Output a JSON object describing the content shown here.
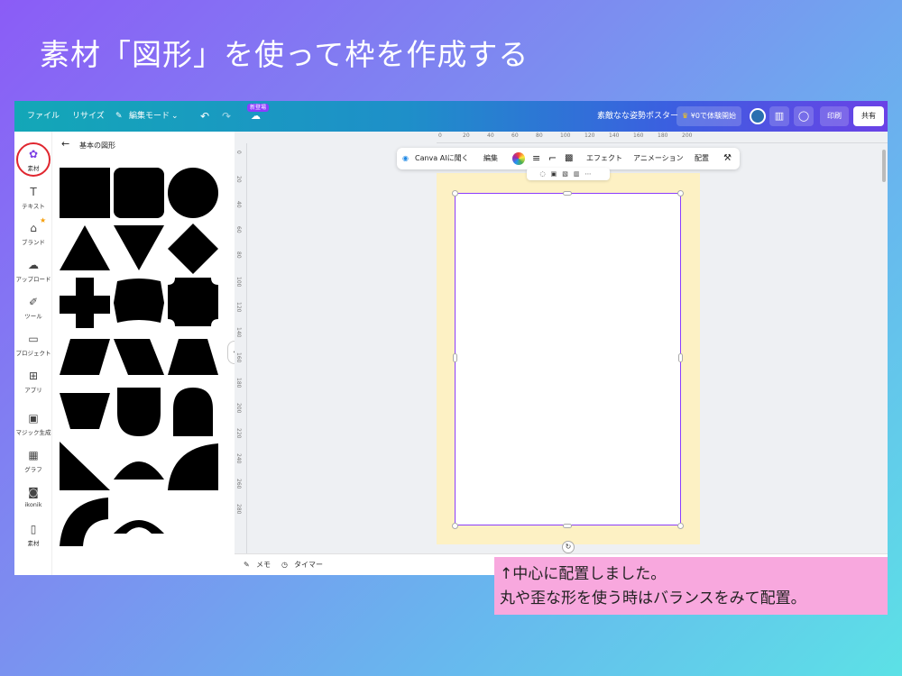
{
  "slide": {
    "title": "素材「図形」を使って枠を作成する",
    "note_line1": "↑中心に配置しました。",
    "note_line2": "丸や歪な形を使う時はバランスをみて配置。"
  },
  "topbar": {
    "file": "ファイル",
    "resize": "リサイズ",
    "edit_mode": "編集モード",
    "new_badge": "新登場",
    "doc_title": "素敵なな姿勢ポスター",
    "trial": "¥0で体験開始",
    "print": "印刷",
    "share": "共有"
  },
  "rail": {
    "items": [
      "素材",
      "テキスト",
      "ブランド",
      "アップロード",
      "ツール",
      "プロジェクト",
      "アプリ",
      "マジック生成",
      "グラフ",
      "ikonik",
      "素材"
    ]
  },
  "panel": {
    "title": "基本の図形"
  },
  "toolbar": {
    "canva_ai": "Canva AIに聞く",
    "edit": "編集",
    "effect": "エフェクト",
    "animation": "アニメーション",
    "arrange": "配置"
  },
  "ruler": {
    "h_ticks": [
      "0",
      "20",
      "40",
      "60",
      "80",
      "100",
      "120",
      "140",
      "160",
      "180",
      "200"
    ],
    "v_ticks": [
      "0",
      "20",
      "40",
      "60",
      "80",
      "100",
      "120",
      "140",
      "160",
      "180",
      "200",
      "220",
      "240",
      "260",
      "280"
    ]
  },
  "bottombar": {
    "memo": "メモ",
    "timer": "タイマー"
  },
  "colors": {
    "page_bg": "#fdf1c4",
    "frame_border": "#8b3dff",
    "active_ring": "#e0262f",
    "note_bg": "#f8a8de"
  }
}
